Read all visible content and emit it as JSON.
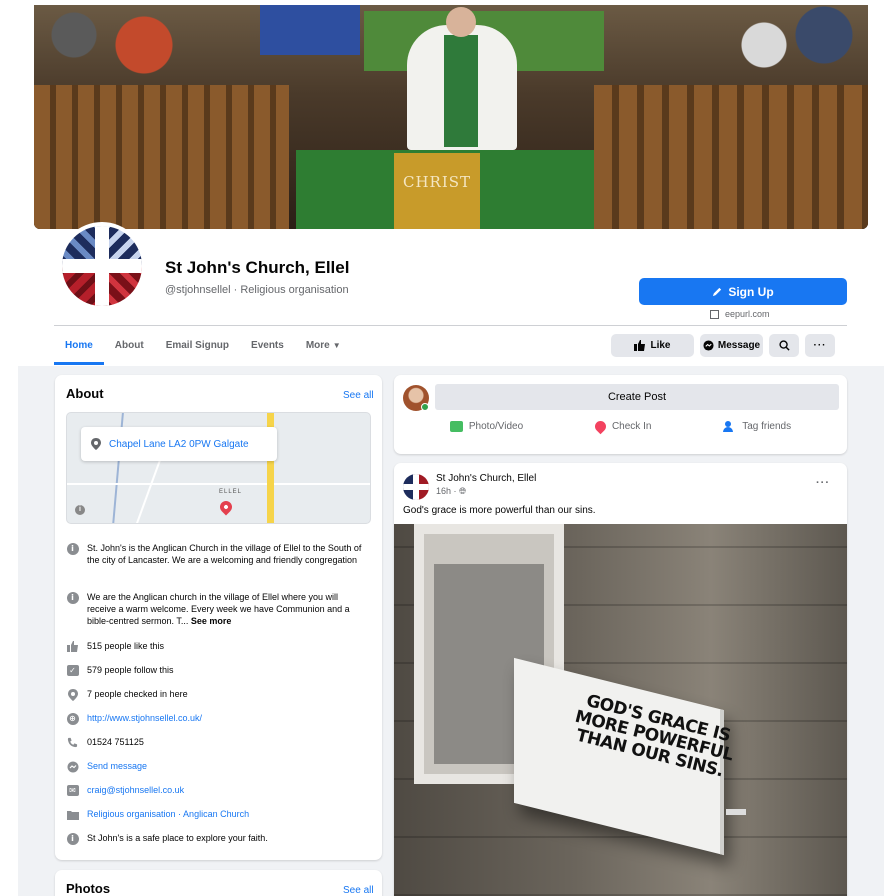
{
  "cover": {
    "altar_text": "CHRIST"
  },
  "profile": {
    "name": "St John's Church, Ellel",
    "handle_line": "@stjohnsellel · Religious organisation"
  },
  "signup": {
    "label": "Sign Up",
    "link": "eepurl.com"
  },
  "tabs": [
    {
      "label": "Home",
      "active": true
    },
    {
      "label": "About"
    },
    {
      "label": "Email Signup"
    },
    {
      "label": "Events"
    },
    {
      "label": "More"
    }
  ],
  "actions": {
    "like": "Like",
    "message": "Message"
  },
  "about": {
    "title": "About",
    "see_all": "See all",
    "map": {
      "address": "Chapel Lane LA2 0PW Galgate",
      "place_label": "ELLEL"
    },
    "rows": [
      {
        "icon": "info-icon",
        "text": "St. John's is the Anglican Church in the village of Ellel to the South of the city of Lancaster. We are a welcoming and friendly congregation"
      },
      {
        "icon": "info-icon",
        "text": "We are the Anglican church in the village of Ellel where you will receive a warm welcome. Every week we have Communion and a bible-centred sermon. T...",
        "more": "See more"
      },
      {
        "icon": "like-icon",
        "text": "515 people like this"
      },
      {
        "icon": "follow-icon",
        "text": "579 people follow this"
      },
      {
        "icon": "checkin-icon",
        "text": "7 people checked in here"
      },
      {
        "icon": "globe-icon",
        "text": "http://www.stjohnsellel.co.uk/",
        "link": true
      },
      {
        "icon": "phone-icon",
        "text": "01524 751125"
      },
      {
        "icon": "messenger-icon",
        "text": "Send message",
        "link": true
      },
      {
        "icon": "email-icon",
        "text": "craig@stjohnsellel.co.uk",
        "link": true
      },
      {
        "icon": "category-icon",
        "text": "Religious organisation · Anglican Church",
        "link": true
      },
      {
        "icon": "info-icon",
        "text": "St John's is a safe place to explore your faith."
      }
    ]
  },
  "photos": {
    "title": "Photos",
    "see_all": "See all"
  },
  "composer": {
    "create_post": "Create Post",
    "photo_video": "Photo/Video",
    "check_in": "Check In",
    "tag_friends": "Tag friends"
  },
  "post": {
    "author": "St John's Church, Ellel",
    "time": "16h · ",
    "text": "God's grace is more powerful than our sins.",
    "sign_text": "GOD'S GRACE IS MORE POWERFUL THAN OUR SINS.",
    "more": "···"
  },
  "colors": {
    "accent": "#1877f2",
    "feed_background": "#f0f2f5",
    "secondary_button": "#e4e6eb"
  }
}
